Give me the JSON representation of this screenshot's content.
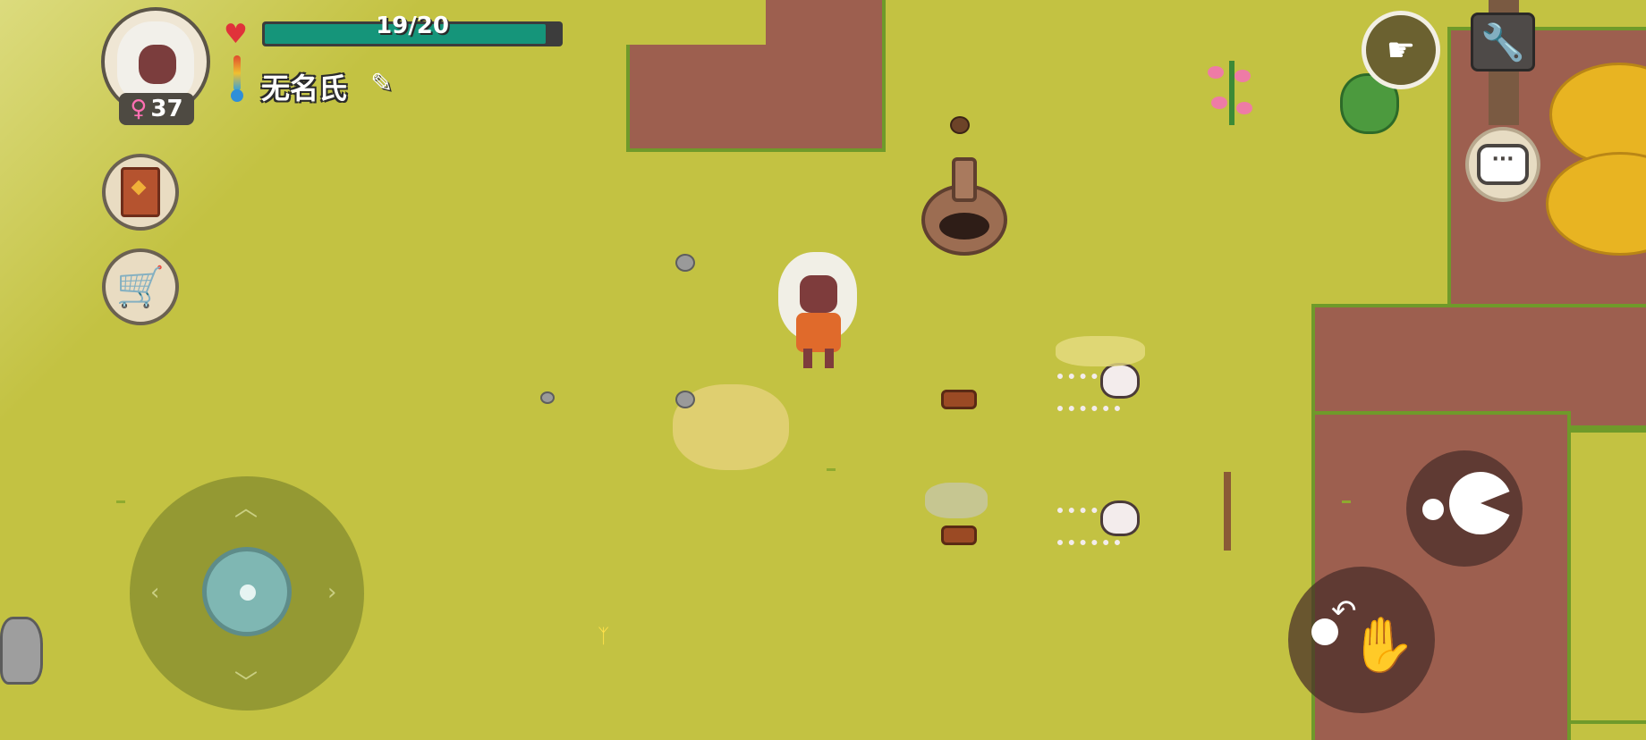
{
  "hud": {
    "health_text": "19/20",
    "health_current": 19,
    "health_max": 20,
    "player_name": "无名氏",
    "level": "37",
    "gender_symbol": "♀"
  },
  "icons": {
    "heart": "heart-icon",
    "thermometer": "thermometer-icon",
    "edit": "pencil-icon",
    "journal": "book-icon",
    "shop": "cart-icon",
    "fast_forward": "pointing-hand-icon",
    "settings": "wrench-icon",
    "chat": "chat-bubble-icon",
    "eat": "eat-mouth-icon",
    "interact": "grab-hand-icon"
  },
  "colors": {
    "health_fill": "#15957a",
    "grass": "#c3c242",
    "dirt": "#9d5f4f"
  },
  "chat": {
    "glyph": "···"
  }
}
